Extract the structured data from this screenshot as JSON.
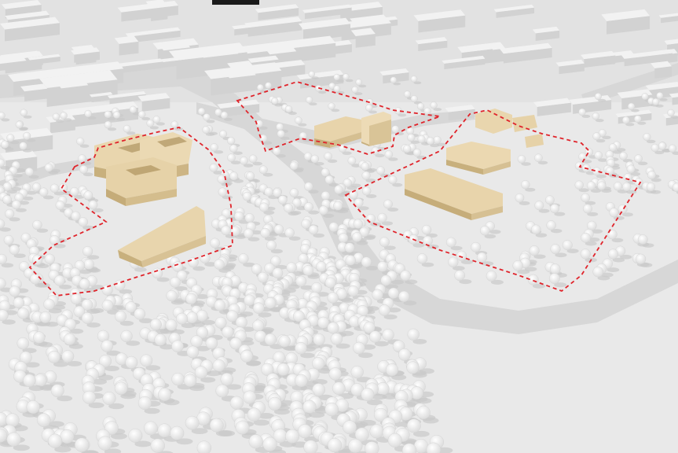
{
  "scene": {
    "kind": "architectural massing model, aerial view",
    "colors": {
      "ground": "#e9e9e9",
      "ground_shade": "#dcdcdc",
      "road": "#d6d6d6",
      "context_building": "#f2f2f2",
      "context_building_side": "#d2d2d2",
      "proposed_building": "#e6d3ab",
      "proposed_building_side": "#c9b17f",
      "tree": "#f7f7f7",
      "tree_shadow": "#c9c9c9",
      "boundary": "#e0242b"
    },
    "boundaries": [
      "west-site",
      "north-site",
      "east-site"
    ],
    "proposed_volumes": 9,
    "text_labels": []
  }
}
